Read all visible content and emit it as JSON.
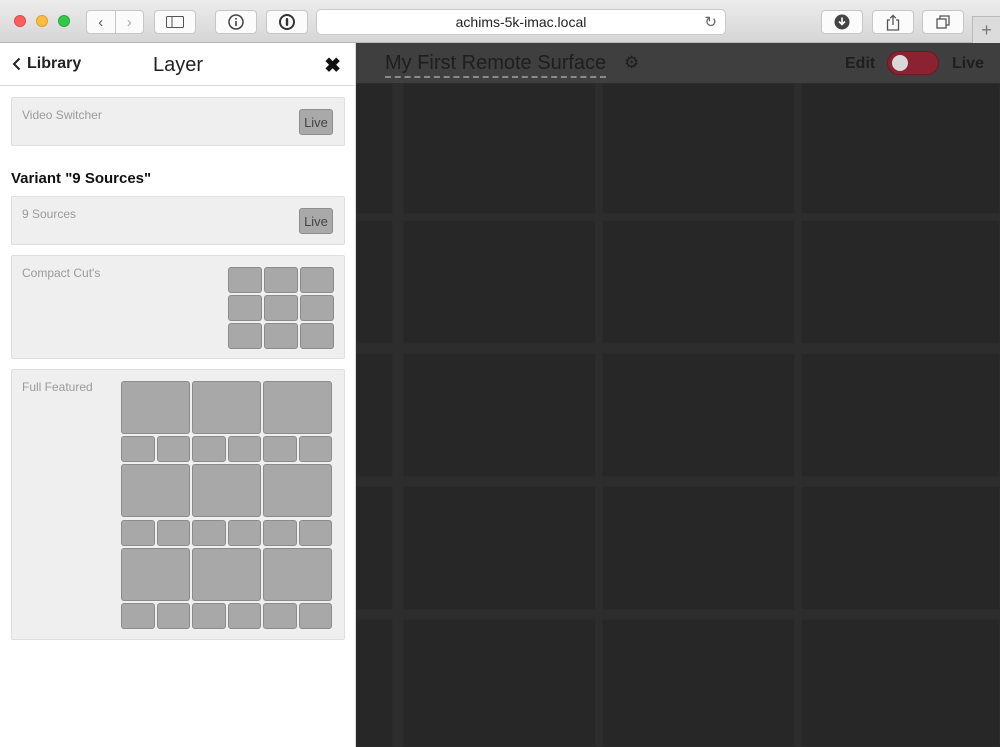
{
  "browser": {
    "url": "achims-5k-imac.local"
  },
  "sidebar": {
    "back_label": "Library",
    "title": "Layer",
    "close_glyph": "✖",
    "cards": [
      {
        "label": "Video Switcher",
        "button": "Live"
      }
    ],
    "variant_title": "Variant \"9 Sources\"",
    "variant_cards": [
      {
        "label": "9 Sources",
        "button": "Live"
      },
      {
        "label": "Compact Cut's"
      },
      {
        "label": "Full Featured"
      }
    ]
  },
  "main": {
    "surface_title": "My First Remote Surface",
    "edit_label": "Edit",
    "live_label": "Live",
    "toggle_color": "#8a2231"
  },
  "colors": {
    "surface_bg": "#2d2d2d",
    "tile": "#a8a8a8"
  }
}
